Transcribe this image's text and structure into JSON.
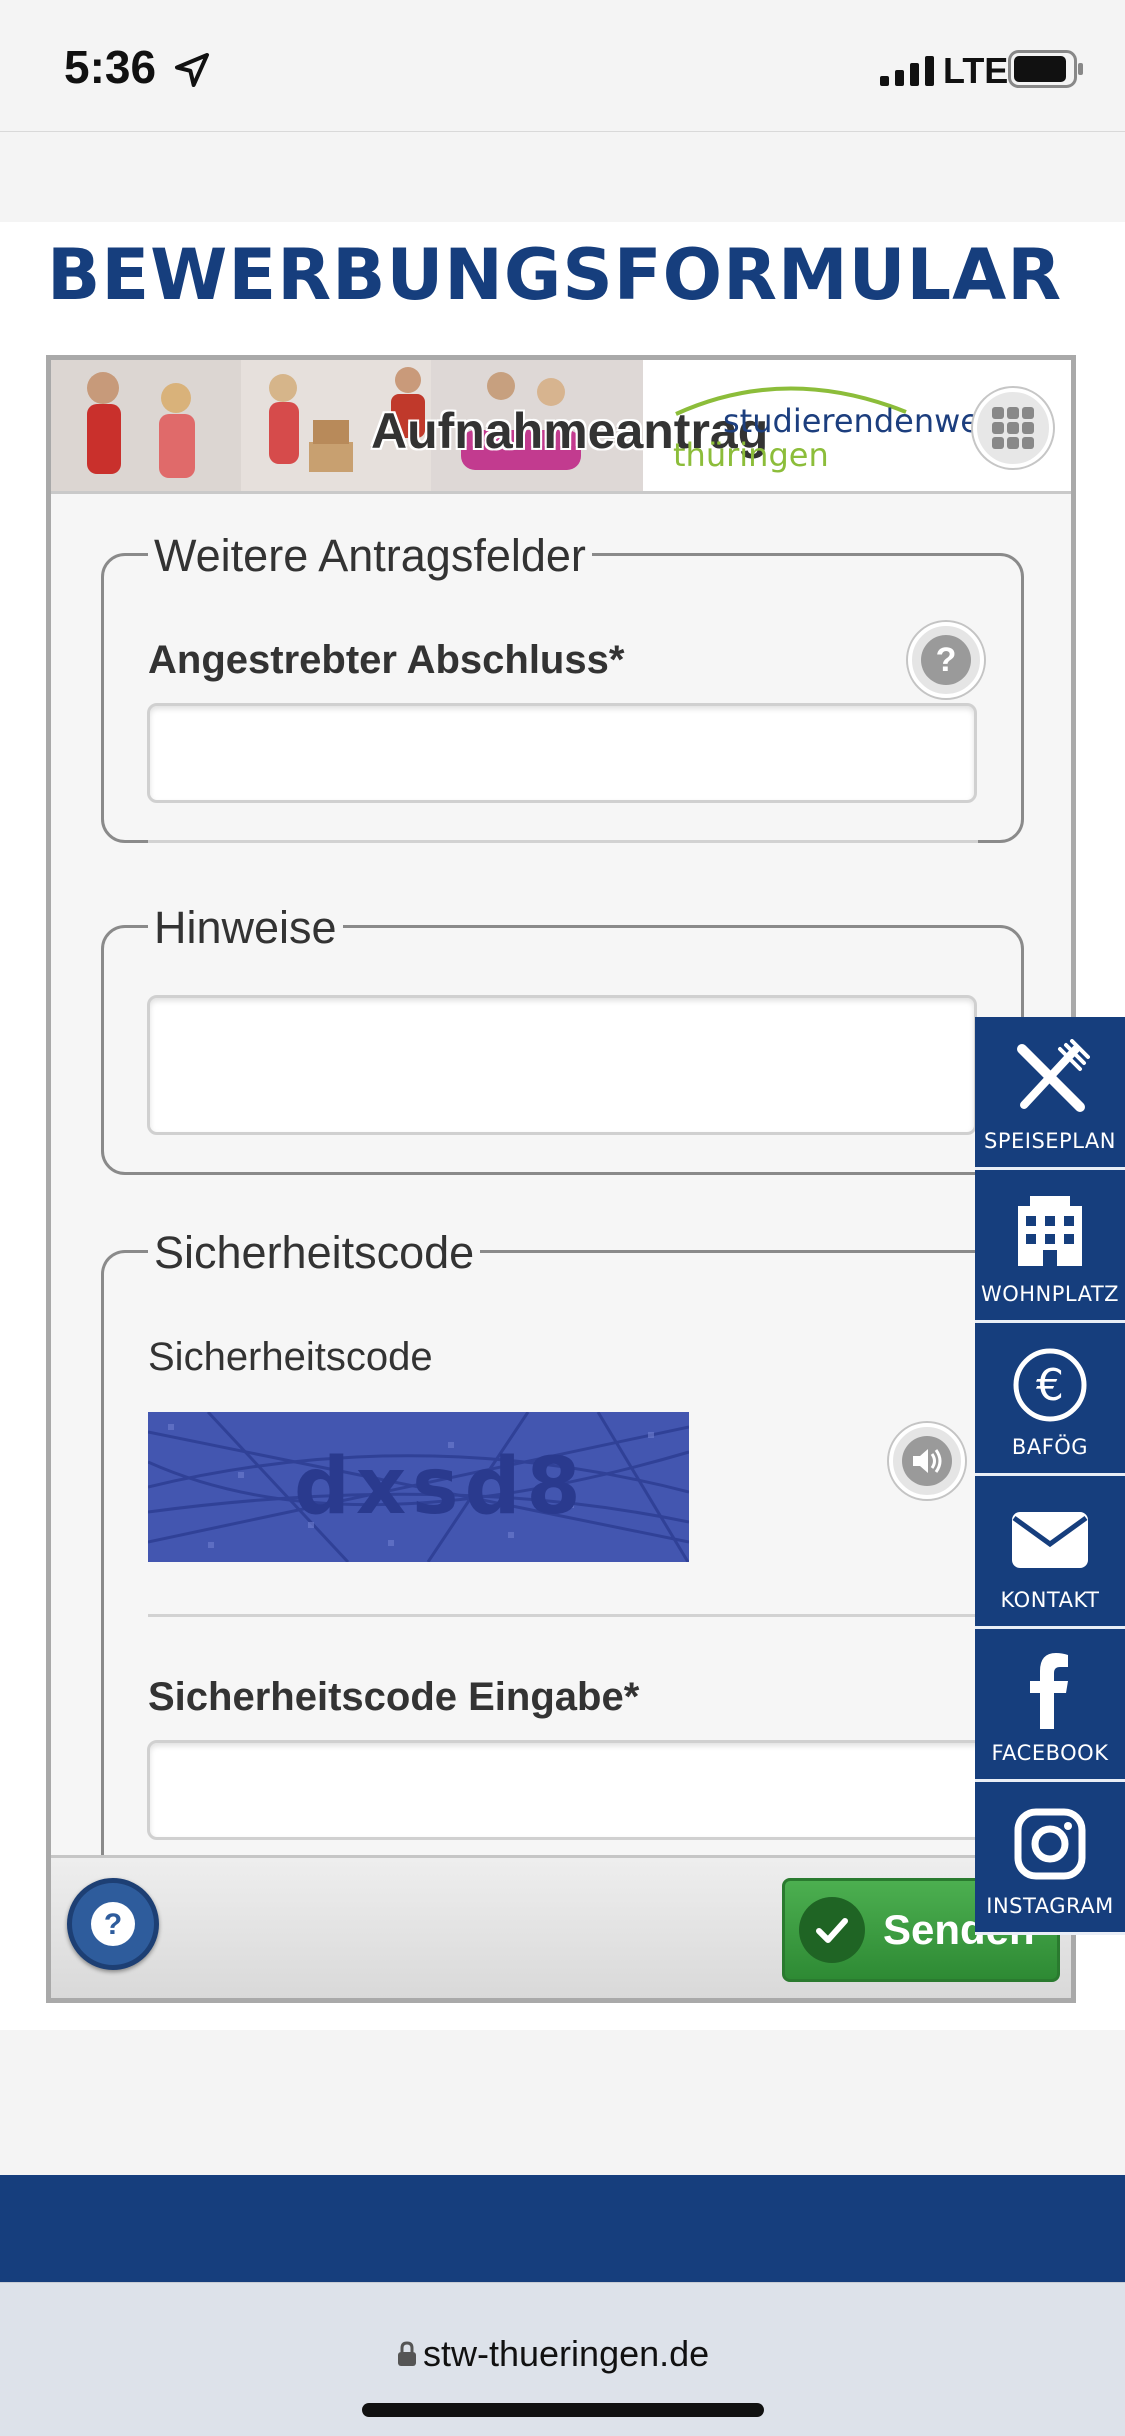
{
  "status_bar": {
    "time": "5:36",
    "network": "LTE"
  },
  "page": {
    "title": "BEWERBUNGSFORMULAR"
  },
  "form": {
    "banner": {
      "title": "Aufnahmeantrag",
      "logo_line1": "studierendenwerk",
      "logo_line2": "thüringen"
    },
    "section_extra": {
      "legend": "Weitere Antragsfelder",
      "field_label": "Angestrebter Abschluss*",
      "field_value": ""
    },
    "section_notes": {
      "legend": "Hinweise",
      "field_value": ""
    },
    "section_captcha": {
      "legend": "Sicherheitscode",
      "image_label": "Sicherheitscode",
      "captcha_text": "dxsd8",
      "input_label": "Sicherheitscode Eingabe*",
      "input_value": ""
    },
    "footer": {
      "send_label": "Senden"
    }
  },
  "side_nav": {
    "items": [
      {
        "label": "SPEISEPLAN",
        "icon": "fork-knife-icon"
      },
      {
        "label": "WOHNPLATZ",
        "icon": "building-icon"
      },
      {
        "label": "BAFÖG",
        "icon": "euro-icon"
      },
      {
        "label": "KONTAKT",
        "icon": "envelope-icon"
      },
      {
        "label": "FACEBOOK",
        "icon": "facebook-icon"
      },
      {
        "label": "INSTAGRAM",
        "icon": "instagram-icon"
      }
    ]
  },
  "browser": {
    "url": "stw-thueringen.de"
  },
  "colors": {
    "brand_blue": "#163e7d",
    "send_green": "#3a9a40",
    "logo_green": "#8cbd3a"
  }
}
